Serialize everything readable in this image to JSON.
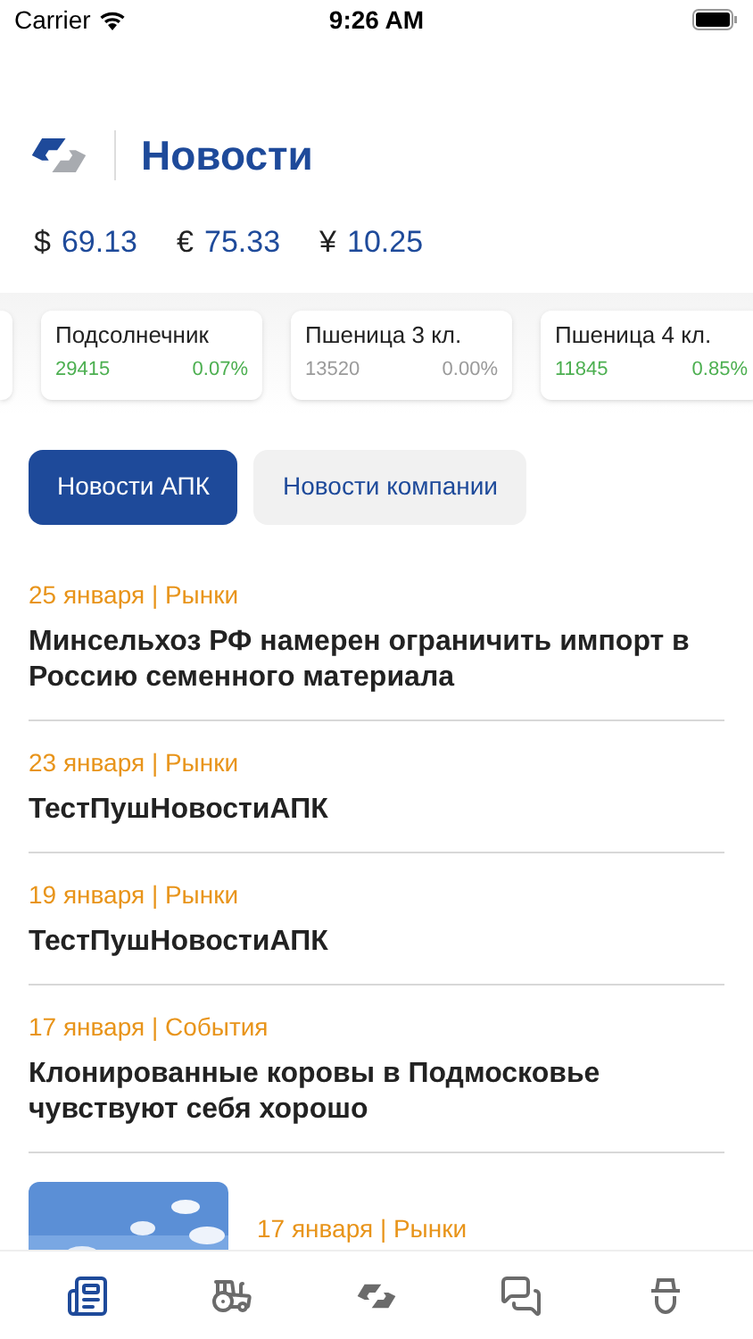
{
  "status_bar": {
    "carrier": "Carrier",
    "time": "9:26 AM"
  },
  "header": {
    "title": "Новости"
  },
  "currencies": [
    {
      "symbol": "$",
      "value": "69.13"
    },
    {
      "symbol": "€",
      "value": "75.33"
    },
    {
      "symbol": "¥",
      "value": "10.25"
    }
  ],
  "tickers": [
    {
      "name": "Подсолнечник",
      "price": "29415",
      "change": "0.07%",
      "color": "#4caf50"
    },
    {
      "name": "Пшеница 3 кл.",
      "price": "13520",
      "change": "0.00%",
      "color": "#9a9a9a"
    },
    {
      "name": "Пшеница 4 кл.",
      "price": "11845",
      "change": "0.85%",
      "color": "#4caf50"
    }
  ],
  "segments": [
    {
      "label": "Новости АПК",
      "selected": true
    },
    {
      "label": "Новости компании",
      "selected": false
    }
  ],
  "news": [
    {
      "meta": "25 января | Рынки",
      "title": "Минсельхоз РФ намерен ограничить импорт в Россию семенного материала"
    },
    {
      "meta": "23 января | Рынки",
      "title": "ТестПушНовостиАПК"
    },
    {
      "meta": "19 января | Рынки",
      "title": "ТестПушНовостиАПК"
    },
    {
      "meta": "17 января | События",
      "title": "Клонированные коровы в Подмосковье чувствуют себя хорошо"
    },
    {
      "meta": "17 января | Рынки",
      "kind": "picture"
    }
  ],
  "tab_bar": [
    {
      "kind": "news",
      "selected": true
    },
    {
      "kind": "tractor",
      "selected": false
    },
    {
      "kind": "logo",
      "selected": false
    },
    {
      "kind": "chat",
      "selected": false
    },
    {
      "kind": "farmer",
      "selected": false
    }
  ]
}
